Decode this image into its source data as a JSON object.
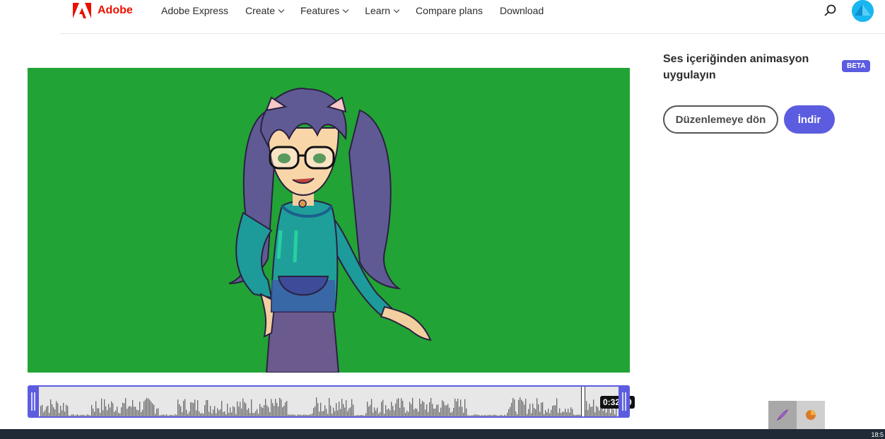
{
  "brand": {
    "name": "Adobe",
    "color": "#eb1000"
  },
  "nav": {
    "items": [
      {
        "label": "Adobe Express",
        "dropdown": false
      },
      {
        "label": "Create",
        "dropdown": true
      },
      {
        "label": "Features",
        "dropdown": true
      },
      {
        "label": "Learn",
        "dropdown": true
      },
      {
        "label": "Compare plans",
        "dropdown": false
      },
      {
        "label": "Download",
        "dropdown": false
      }
    ]
  },
  "icons": {
    "search": "search-icon",
    "avatar": "avatar",
    "pen_tray": "pen-icon",
    "pie_tray": "pie-chart-icon"
  },
  "preview": {
    "background": "#22a335"
  },
  "timeline": {
    "time": "0:32.79",
    "accent": "#5c5ce0"
  },
  "panel": {
    "title": "Ses içeriğinden animasyon uygulayın",
    "badge": "BETA",
    "back_button": "Düzenlemeye dön",
    "download_button": "İndir"
  },
  "taskbar": {
    "clock": "18:5"
  }
}
